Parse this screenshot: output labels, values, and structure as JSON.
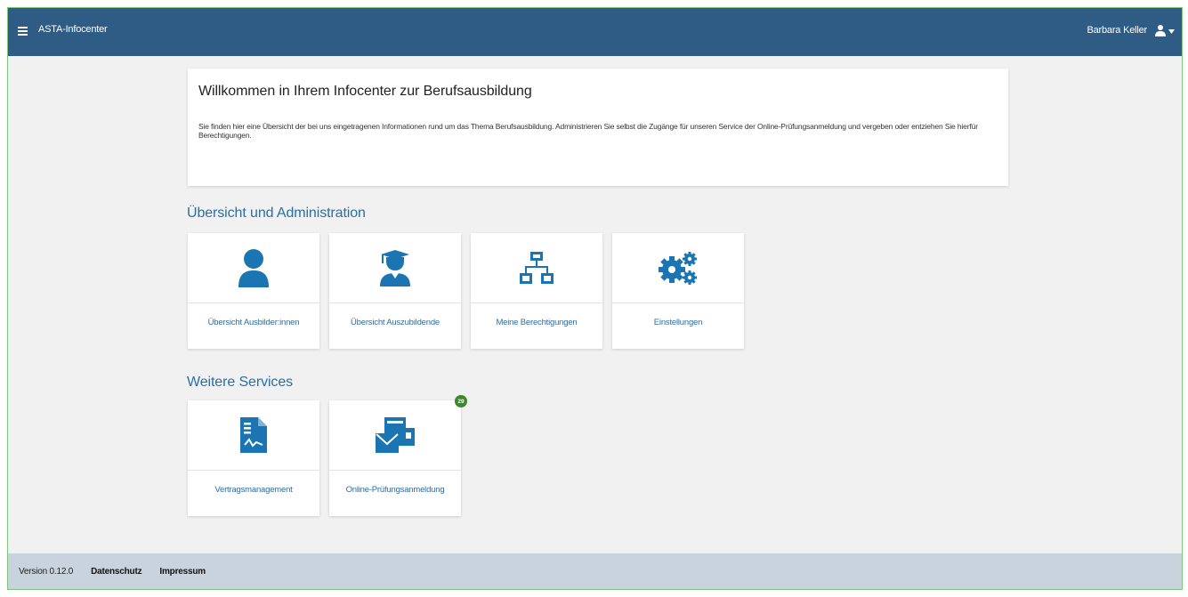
{
  "header": {
    "app_title": "ASTA-Infocenter",
    "user_name": "Barbara Keller",
    "background_color": "#2f5c85"
  },
  "welcome": {
    "title": "Willkommen in Ihrem Infocenter zur Berufsausbildung",
    "text": "Sie finden hier eine Übersicht der bei uns eingetragenen Informationen rund um das Thema Berufsausbildung. Administrieren Sie selbst die Zugänge für unseren Service der Online-Prüfungsanmeldung und vergeben oder entziehen Sie hierfür Berechtigungen."
  },
  "admin_section": {
    "title": "Übersicht und Administration",
    "tiles": [
      {
        "label": "Übersicht Ausbilder:innen",
        "icon": "person-icon"
      },
      {
        "label": "Übersicht Auszubildende",
        "icon": "graduate-icon"
      },
      {
        "label": "Meine Berechtigungen",
        "icon": "network-icon"
      },
      {
        "label": "Einstellungen",
        "icon": "gears-icon"
      }
    ]
  },
  "services_section": {
    "title": "Weitere Services",
    "tiles": [
      {
        "label": "Vertragsmanagement",
        "icon": "contract-document-icon"
      },
      {
        "label": "Online-Prüfungsanmeldung",
        "icon": "mail-form-icon",
        "badge": "29"
      }
    ]
  },
  "footer": {
    "version": "Version 0.12.0",
    "privacy_link": "Datenschutz",
    "imprint_link": "Impressum"
  },
  "colors": {
    "accent": "#1a75b2",
    "section_title": "#2870a5",
    "badge": "#3a8a2a",
    "footer_bg": "#c8d3de"
  }
}
